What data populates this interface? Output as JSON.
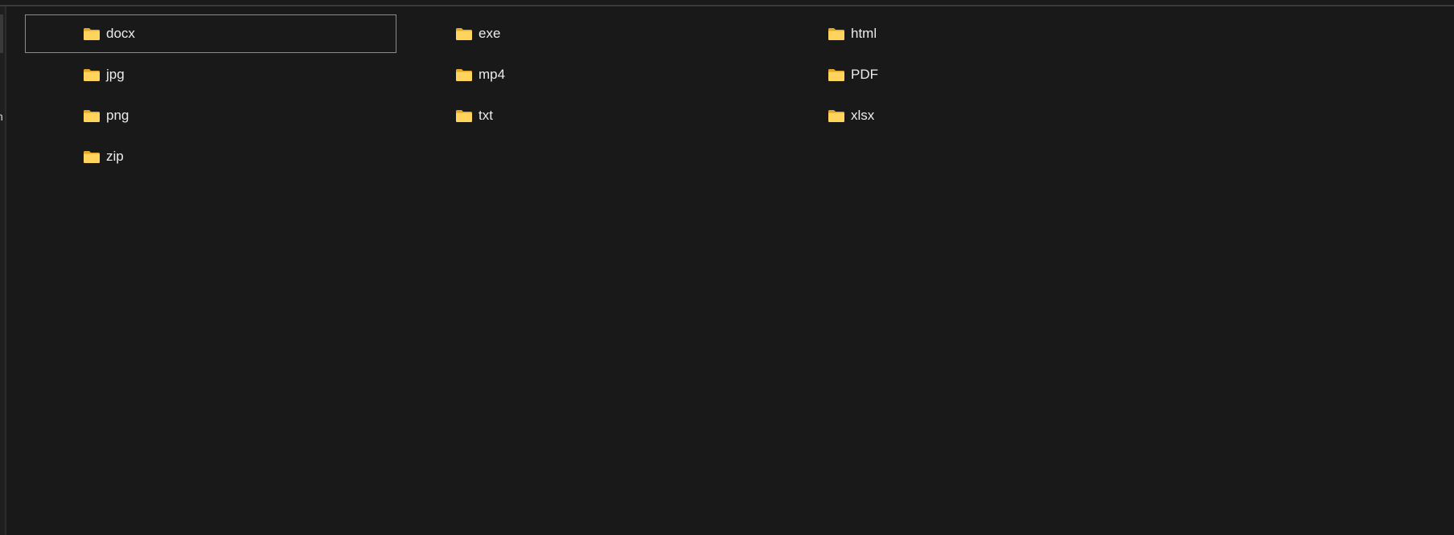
{
  "folder_view": {
    "selected_item": "docx",
    "folders": [
      {
        "name": "docx",
        "icon": "folder-icon"
      },
      {
        "name": "exe",
        "icon": "folder-icon"
      },
      {
        "name": "html",
        "icon": "folder-icon"
      },
      {
        "name": "jpg",
        "icon": "folder-icon"
      },
      {
        "name": "mp4",
        "icon": "folder-icon"
      },
      {
        "name": "PDF",
        "icon": "folder-icon"
      },
      {
        "name": "png",
        "icon": "folder-icon"
      },
      {
        "name": "txt",
        "icon": "folder-icon"
      },
      {
        "name": "xlsx",
        "icon": "folder-icon"
      },
      {
        "name": "zip",
        "icon": "folder-icon"
      }
    ]
  },
  "theme": {
    "background": "#191919",
    "text": "#ececec",
    "folder_icon_front": "#ffd45c",
    "folder_icon_back": "#e2a82a",
    "selection_border": "#8b8b8b"
  }
}
